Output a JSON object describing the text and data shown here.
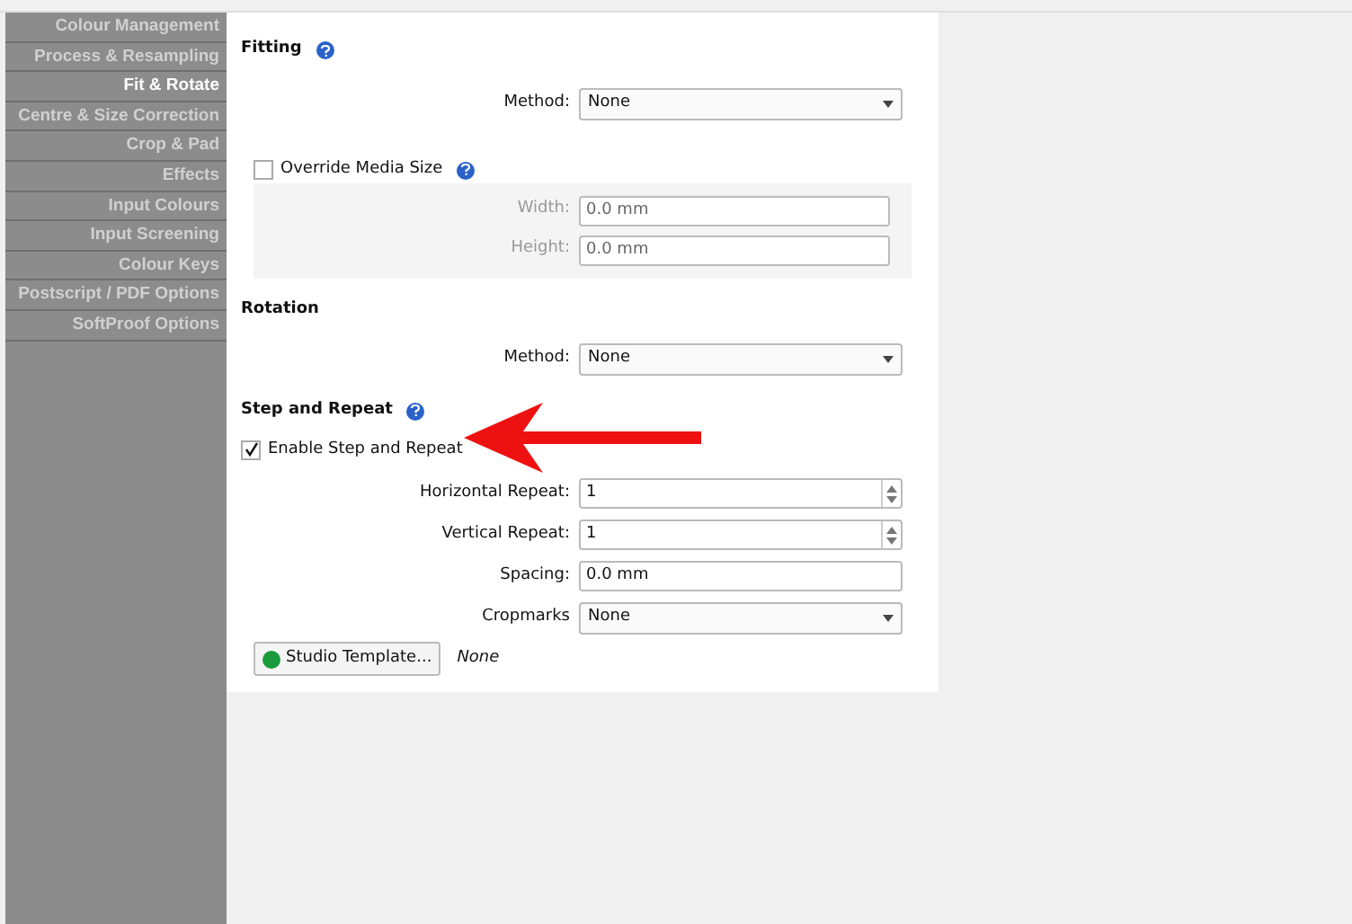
{
  "sidebar": {
    "items": [
      {
        "label": "Colour Management",
        "selected": false
      },
      {
        "label": "Process & Resampling",
        "selected": false
      },
      {
        "label": "Fit & Rotate",
        "selected": true
      },
      {
        "label": "Centre & Size Correction",
        "selected": false
      },
      {
        "label": "Crop & Pad",
        "selected": false
      },
      {
        "label": "Effects",
        "selected": false
      },
      {
        "label": "Input Colours",
        "selected": false
      },
      {
        "label": "Input Screening",
        "selected": false
      },
      {
        "label": "Colour Keys",
        "selected": false
      },
      {
        "label": "Postscript / PDF Options",
        "selected": false
      },
      {
        "label": "SoftProof Options",
        "selected": false
      }
    ]
  },
  "fitting": {
    "title": "Fitting",
    "method_label": "Method:",
    "method_value": "None",
    "override": {
      "label": "Override Media Size",
      "checked": false
    },
    "fields": [
      {
        "label": "Width:",
        "value": "0.0 mm",
        "disabled": true
      },
      {
        "label": "Height:",
        "value": "0.0 mm",
        "disabled": true
      }
    ]
  },
  "rotation": {
    "title": "Rotation",
    "method_label": "Method:",
    "method_value": "None"
  },
  "step_and_repeat": {
    "title": "Step and Repeat",
    "enable": {
      "label": "Enable Step and Repeat",
      "checked": true
    },
    "fields": [
      {
        "kind": "spinner",
        "label": "Horizontal Repeat:",
        "value": "1"
      },
      {
        "kind": "spinner",
        "label": "Vertical Repeat:",
        "value": "1"
      },
      {
        "kind": "text",
        "label": "Spacing:",
        "value": "0.0 mm"
      },
      {
        "kind": "dropdown",
        "label": "Cropmarks",
        "value": "None"
      }
    ],
    "template_button": {
      "label": "Studio Template...",
      "color": "#1a9a3a"
    },
    "template_value": "None"
  }
}
